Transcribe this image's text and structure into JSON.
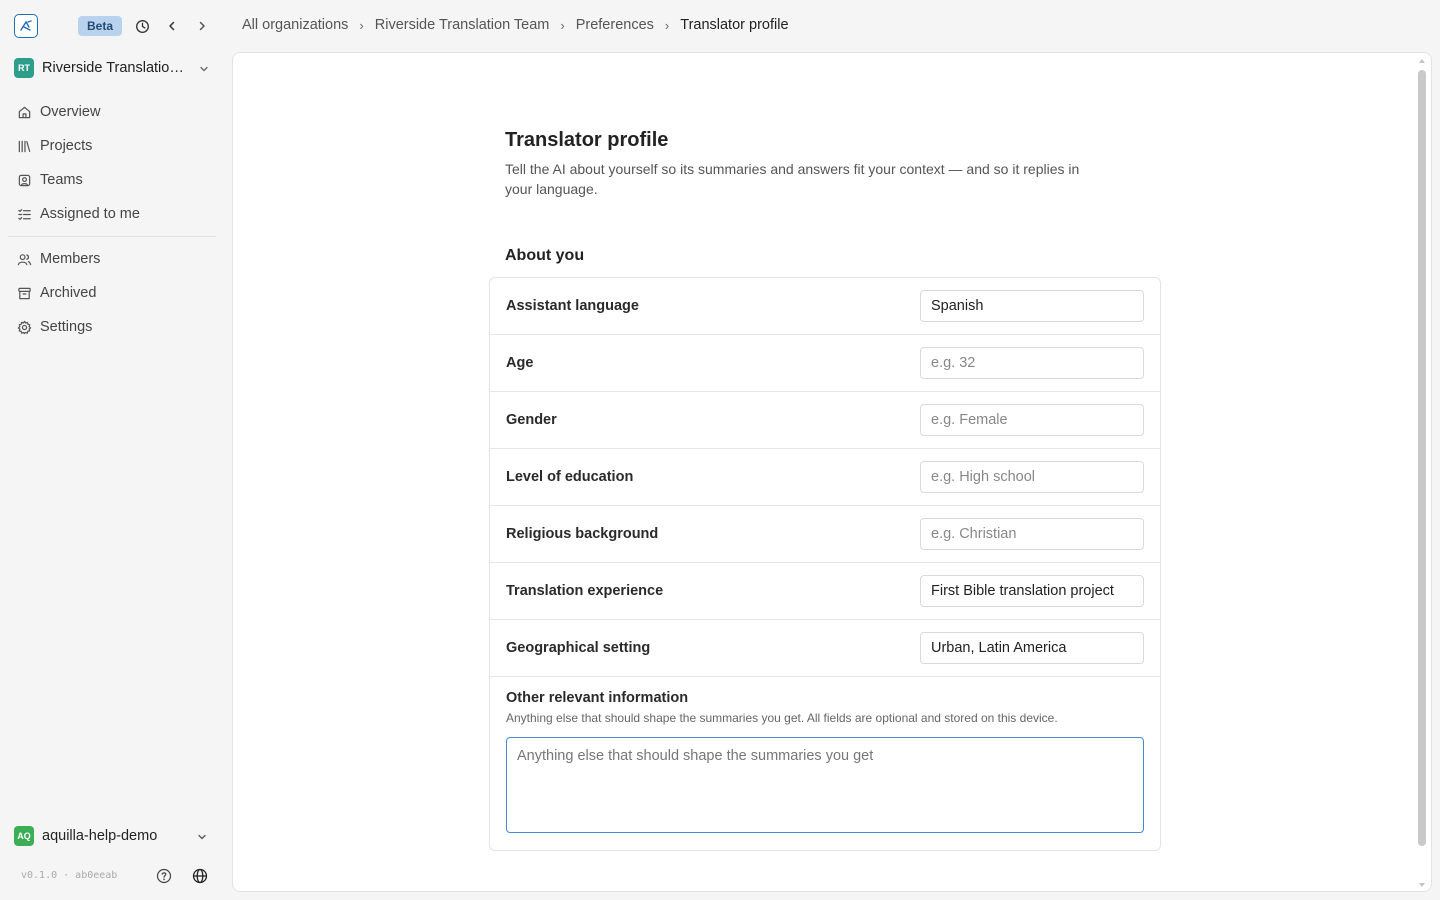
{
  "topbar": {
    "beta_label": "Beta",
    "icons": [
      "app-logo-icon",
      "history-icon",
      "back-arrow-icon",
      "forward-arrow-icon"
    ]
  },
  "breadcrumb": {
    "items": [
      "All organizations",
      "Riverside Translation Team",
      "Preferences",
      "Translator profile"
    ],
    "separator": "›"
  },
  "sidebar": {
    "org": {
      "initials": "RT",
      "name": "Riverside Translation Team",
      "color": "#2e9d8c"
    },
    "items": [
      {
        "label": "Overview",
        "icon": "home-icon"
      },
      {
        "label": "Projects",
        "icon": "library-icon"
      },
      {
        "label": "Teams",
        "icon": "team-icon"
      },
      {
        "label": "Assigned to me",
        "icon": "checklist-icon"
      },
      {
        "label": "Members",
        "icon": "users-icon"
      },
      {
        "label": "Archived",
        "icon": "archive-icon"
      },
      {
        "label": "Settings",
        "icon": "gear-icon"
      }
    ],
    "user": {
      "initials": "AQ",
      "name": "aquilla-help-demo",
      "color": "#3cae55"
    },
    "version": "v0.1.0 · ab0eeab"
  },
  "profile": {
    "title": "Translator profile",
    "description": "Tell the AI about yourself so its summaries and answers fit your context — and so it replies in your language.",
    "section_title": "About you",
    "fields": [
      {
        "label": "Assistant language",
        "value": "Spanish",
        "placeholder": ""
      },
      {
        "label": "Age",
        "value": "",
        "placeholder": "e.g. 32"
      },
      {
        "label": "Gender",
        "value": "",
        "placeholder": "e.g. Female"
      },
      {
        "label": "Level of education",
        "value": "",
        "placeholder": "e.g. High school"
      },
      {
        "label": "Religious background",
        "value": "",
        "placeholder": "e.g. Christian"
      },
      {
        "label": "Translation experience",
        "value": "First Bible translation project",
        "placeholder": ""
      },
      {
        "label": "Geographical setting",
        "value": "Urban, Latin America",
        "placeholder": ""
      }
    ],
    "other": {
      "label": "Other relevant information",
      "help": "Anything else that should shape the summaries you get. All fields are optional and stored on this device.",
      "placeholder": "Anything else that should shape the summaries you get",
      "value": ""
    }
  },
  "colors": {
    "accent": "#1e6fb8",
    "beta_bg": "#b9d3ef",
    "focus_border": "#4a8bd0"
  }
}
